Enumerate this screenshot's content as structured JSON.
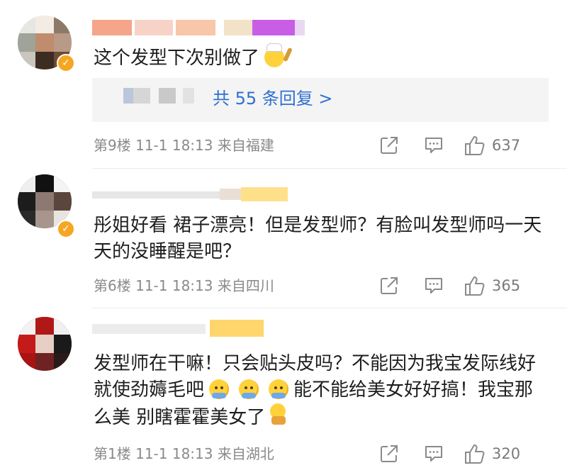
{
  "comments": [
    {
      "text": "这个发型下次别做了",
      "emoji_after": "chef-emoji",
      "replies_label": "共 55 条回复 >",
      "floor": "第9楼",
      "date": "11-1 18:13",
      "location": "来自福建",
      "likes": "637"
    },
    {
      "text": "彤姐好看 裙子漂亮！但是发型师？有脸叫发型师吗一天天的没睡醒是吧？",
      "floor": "第6楼",
      "date": "11-1 18:13",
      "location": "来自四川",
      "likes": "365"
    },
    {
      "text_part1": "发型师在干嘛！只会贴头皮吗？不能因为我宝发际线好就使劲薅毛吧",
      "text_part2": "能不能给美女好好搞！我宝那么美 别瞎霍霍美女了",
      "emojis": [
        "pray-emoji",
        "pray-emoji",
        "pray-emoji"
      ],
      "emoji_end": "kneel-emoji",
      "floor": "第1楼",
      "date": "11-1 18:13",
      "location": "来自湖北",
      "likes": "320"
    }
  ],
  "icons": {
    "share": "share-icon",
    "comment": "comment-icon",
    "like": "like-icon",
    "verified": "verified-badge-icon"
  },
  "colors": {
    "link_blue": "#2f6fd1",
    "meta_gray": "#8a8a8a",
    "badge_orange": "#f5a623",
    "reply_bg": "#f4f4f4"
  }
}
